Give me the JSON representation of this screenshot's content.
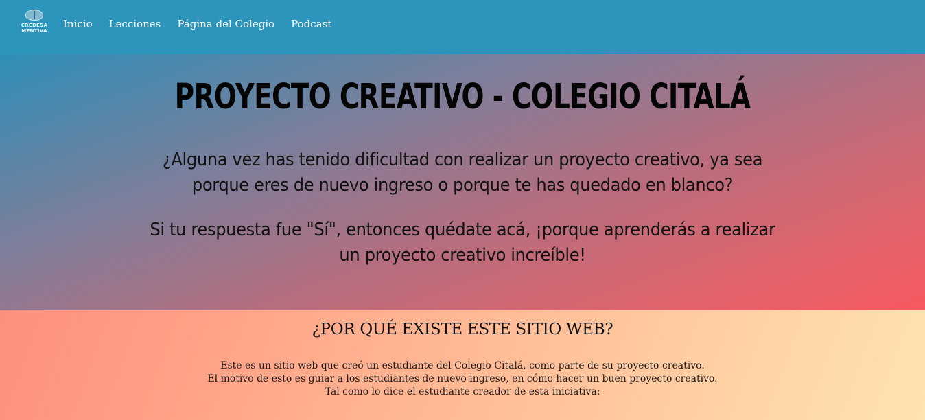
{
  "nav": {
    "logo_text_line1": "CREDESA",
    "logo_text_line2": "MENTIVA",
    "links": [
      {
        "label": "Inicio"
      },
      {
        "label": "Lecciones"
      },
      {
        "label": "Página del Colegio"
      },
      {
        "label": "Podcast"
      }
    ],
    "background_color": "#2d94bb"
  },
  "hero": {
    "title": "PROYECTO CREATIVO - COLEGIO CITALÁ",
    "paragraph1": "¿Alguna vez has tenido dificultad con realizar un proyecto creativo, ya sea porque eres de nuevo ingreso o porque te has quedado en blanco?",
    "paragraph2": "Si tu respuesta fue \"Sí\", entonces quédate acá, ¡porque aprenderás a realizar un proyecto creativo increíble!"
  },
  "about": {
    "title": "¿POR QUÉ EXISTE ESTE SITIO WEB?",
    "lines": [
      "Este es un sitio web que creó un estudiante del Colegio Citalá, como parte de su proyecto creativo.",
      "El motivo de esto es guiar a los estudiantes de nuevo ingreso, en cómo hacer un buen proyecto creativo.",
      "Tal como lo dice el estudiante creador de esta iniciativa:"
    ]
  }
}
